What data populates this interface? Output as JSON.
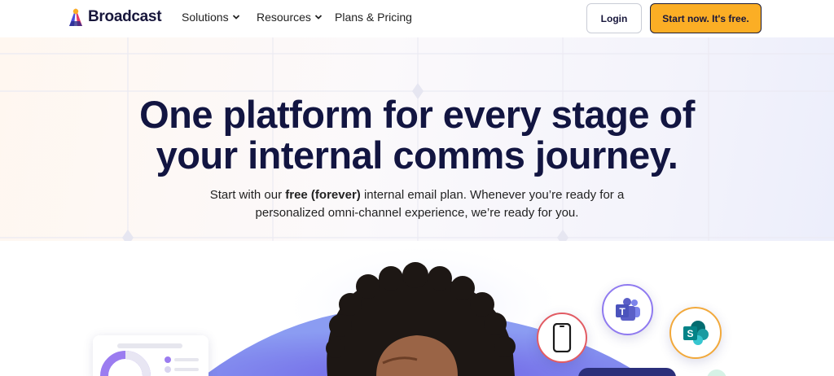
{
  "nav": {
    "brand": "Broadcast",
    "items": [
      {
        "label": "Solutions",
        "has_dropdown": true
      },
      {
        "label": "Resources",
        "has_dropdown": true
      },
      {
        "label": "Plans & Pricing",
        "has_dropdown": false
      }
    ],
    "login_label": "Login",
    "cta_label": "Start now. It's free."
  },
  "hero": {
    "headline_line1": "One platform for every stage of",
    "headline_line2": "your internal comms journey.",
    "sub_before": "Start with our ",
    "sub_bold": "free (forever)",
    "sub_after_line1": " internal email plan. Whenever you’re ready for a",
    "sub_line2": "personalized omni-channel experience, we’re ready for you."
  },
  "colors": {
    "cta": "#fbae25",
    "headline": "#121541",
    "teams": "#5b5fc7",
    "sharepoint": "#038387",
    "accent_blue": "#5b6ee0"
  },
  "icons": [
    "broadcast-logo-icon",
    "chevron-down-icon",
    "mobile-phone-icon",
    "microsoft-teams-icon",
    "sharepoint-icon"
  ]
}
